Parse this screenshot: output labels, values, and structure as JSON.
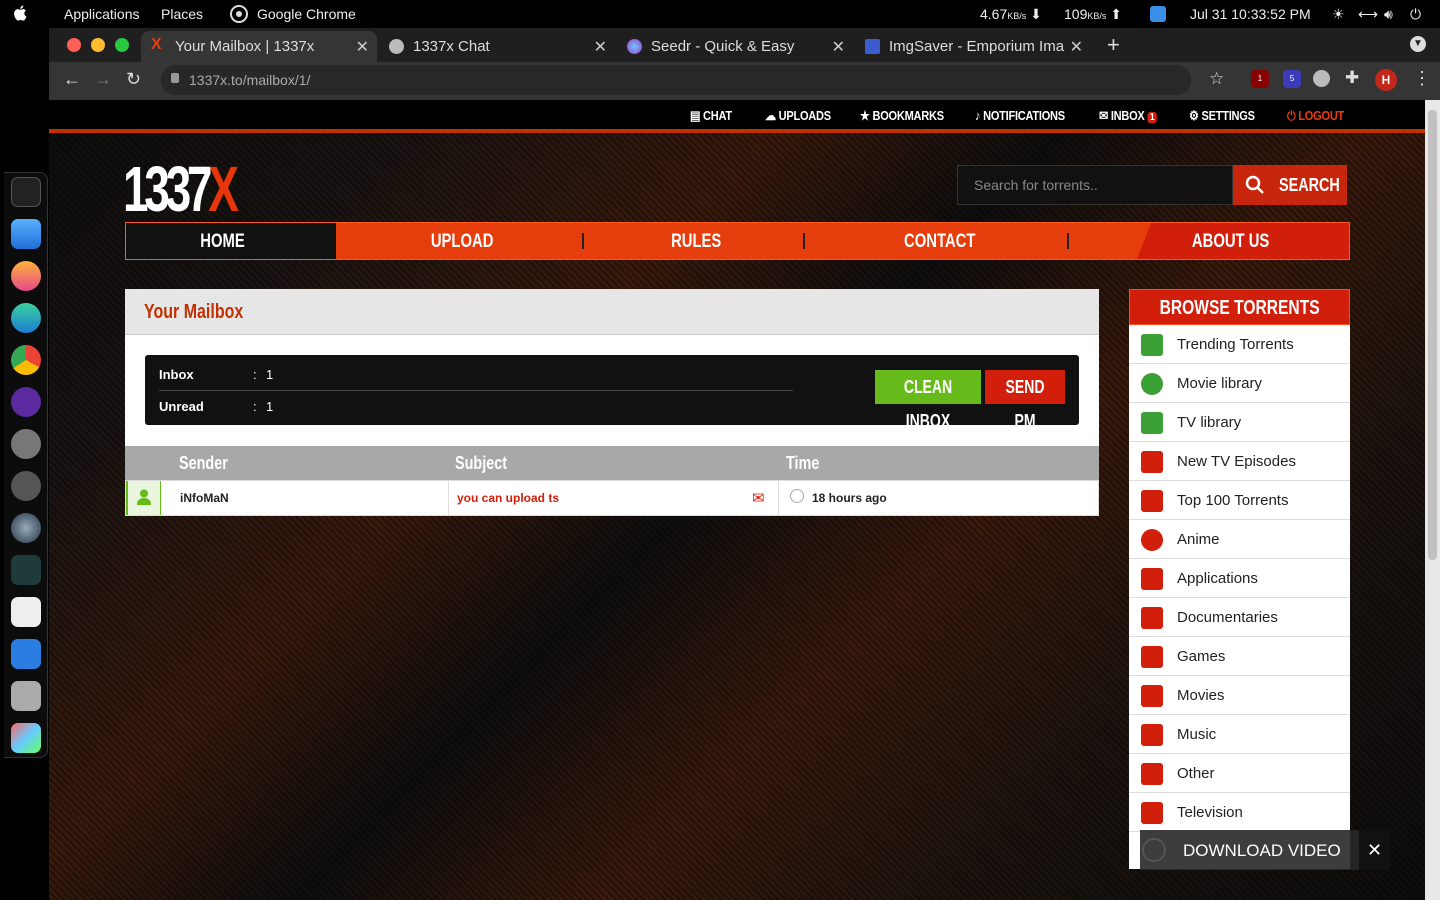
{
  "topbar": {
    "applications": "Applications",
    "places": "Places",
    "chrome": "Google Chrome",
    "net_down": "4.67",
    "net_down_unit": "KB/s",
    "net_up": "109",
    "net_up_unit": "KB/s",
    "datetime": "Jul 31  10:33:52 PM"
  },
  "tabs": [
    {
      "title": "Your Mailbox | 1337x"
    },
    {
      "title": "1337x Chat"
    },
    {
      "title": "Seedr - Quick & Easy"
    },
    {
      "title": "ImgSaver - Emporium Ima"
    }
  ],
  "address": {
    "url": "1337x.to/mailbox/1/"
  },
  "extensions": {
    "ublock_count": "1",
    "ext2_count": "5",
    "avatar": "H"
  },
  "usernav": {
    "chat": "CHAT",
    "uploads": "UPLOADS",
    "bookmarks": "BOOKMARKS",
    "notifications": "NOTIFICATIONS",
    "inbox": "INBOX",
    "inbox_count": "1",
    "settings": "SETTINGS",
    "logout": "LOGOUT"
  },
  "logo": {
    "main": "1337",
    "accent": "X"
  },
  "search": {
    "placeholder": "Search for torrents..",
    "button": "SEARCH"
  },
  "mainnav": {
    "home": "HOME",
    "upload": "UPLOAD",
    "rules": "RULES",
    "contact": "CONTACT",
    "about": "ABOUT US"
  },
  "mailbox": {
    "title": "Your Mailbox",
    "inbox_label": "Inbox",
    "inbox_value": "1",
    "unread_label": "Unread",
    "unread_value": "1",
    "clean_btn": "CLEAN INBOX",
    "send_btn": "SEND PM",
    "columns": {
      "sender": "Sender",
      "subject": "Subject",
      "time": "Time"
    },
    "rows": [
      {
        "sender": "iNfoMaN",
        "subject": "you can upload ts",
        "time": "18 hours ago"
      }
    ]
  },
  "sidebar": {
    "title": "BROWSE TORRENTS",
    "items": [
      {
        "label": "Trending Torrents",
        "icon": "trending-icon"
      },
      {
        "label": "Movie library",
        "icon": "film-reel-icon"
      },
      {
        "label": "TV library",
        "icon": "tv-library-icon"
      },
      {
        "label": "New TV Episodes",
        "icon": "tv-icon"
      },
      {
        "label": "Top 100 Torrents",
        "icon": "top-icon"
      },
      {
        "label": "Anime",
        "icon": "anime-icon"
      },
      {
        "label": "Applications",
        "icon": "windows-icon"
      },
      {
        "label": "Documentaries",
        "icon": "camera-icon"
      },
      {
        "label": "Games",
        "icon": "gamepad-icon"
      },
      {
        "label": "Movies",
        "icon": "clapper-icon"
      },
      {
        "label": "Music",
        "icon": "music-icon"
      },
      {
        "label": "Other",
        "icon": "box-icon"
      },
      {
        "label": "Television",
        "icon": "tv-icon"
      }
    ]
  },
  "download_video": {
    "label": "DOWNLOAD VIDEO",
    "close": "✕"
  },
  "colors": {
    "accent": "#e63d0c",
    "red": "#d11f0b",
    "green": "#66bb1b"
  }
}
